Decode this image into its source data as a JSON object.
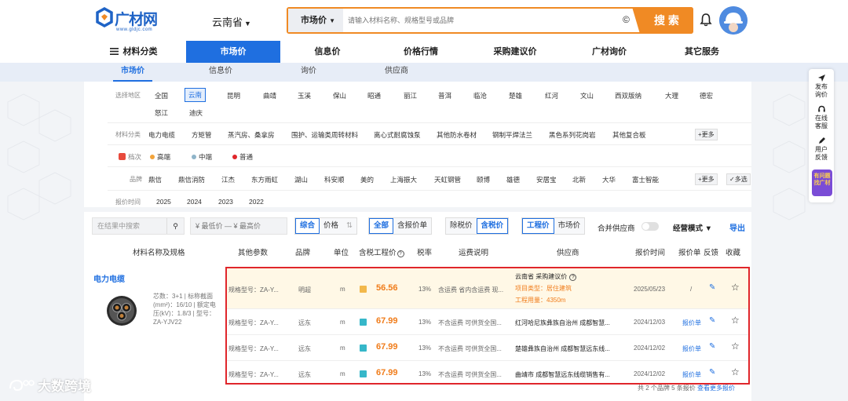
{
  "header": {
    "logo_name": "广材网",
    "logo_url": "www.gldjc.com",
    "region": "云南省",
    "search_type": "市场价",
    "search_placeholder": "请输入材料名称、规格型号或品牌",
    "search_button": "搜 索"
  },
  "main_nav": {
    "items": [
      {
        "label": "材料分类"
      },
      {
        "label": "市场价"
      },
      {
        "label": "信息价"
      },
      {
        "label": "价格行情"
      },
      {
        "label": "采购建议价"
      },
      {
        "label": "广材询价"
      },
      {
        "label": "其它服务"
      }
    ]
  },
  "sub_nav": {
    "items": [
      {
        "label": "市场价"
      },
      {
        "label": "信息价"
      },
      {
        "label": "询价"
      },
      {
        "label": "供应商"
      }
    ]
  },
  "filters": {
    "region": {
      "label": "选择地区",
      "options": [
        "全国",
        "云南",
        "昆明",
        "曲靖",
        "玉溪",
        "保山",
        "昭通",
        "丽江",
        "普洱",
        "临沧",
        "楚雄",
        "红河",
        "文山",
        "西双版纳",
        "大理",
        "德宏",
        "怒江",
        "迪庆"
      ]
    },
    "category": {
      "label": "材料分类",
      "options": [
        "电力电缆",
        "方矩管",
        "蒸汽房、桑拿房",
        "围护、运输类周转材料",
        "离心式耐腐蚀泵",
        "其他防水卷材",
        "钢制平焊法兰",
        "黑色系列花岗岩",
        "其他复合板"
      ],
      "more": "更多"
    },
    "tier": {
      "label": "档次",
      "options": [
        {
          "label": "高端",
          "color": "#f2a33a"
        },
        {
          "label": "中端",
          "color": "#8fb4c9"
        },
        {
          "label": "普通",
          "color": "#e0262b"
        }
      ]
    },
    "brand": {
      "label": "品牌",
      "options": [
        "鼎信",
        "鼎信消防",
        "江杰",
        "东方雨虹",
        "湖山",
        "科安顺",
        "美的",
        "上海振大",
        "天虹钢管",
        "颐博",
        "雄德",
        "安居宝",
        "北新",
        "大华",
        "富士智能"
      ],
      "more": "更多",
      "multi": "多选"
    },
    "time": {
      "label": "报价时间",
      "options": [
        "2025",
        "2024",
        "2023",
        "2022"
      ]
    }
  },
  "toolbar": {
    "search_placeholder": "在结果中搜索",
    "price_range": "¥ 最低价 — ¥ 最高价",
    "sort": [
      "综合",
      "价格"
    ],
    "scope": [
      "全部",
      "含报价单"
    ],
    "tax": [
      "除税价",
      "含税价"
    ],
    "price_type": [
      "工程价",
      "市场价"
    ],
    "merge_label": "合并供应商",
    "mode_label": "经营模式",
    "export_label": "导出"
  },
  "table": {
    "headers": {
      "name": "材料名称及规格",
      "params": "其他参数",
      "brand": "品牌",
      "unit": "单位",
      "price": "含税工程价",
      "tax": "税率",
      "freight": "运费说明",
      "supplier": "供应商",
      "time": "报价时间",
      "quote": "报价单",
      "feedback": "反馈",
      "fav": "收藏"
    }
  },
  "product": {
    "category": "电力电缆",
    "specs": "芯数：3+1 | 标称截面(mm²)：16/10 | 额定电压(kV)：1.8/3 | 型号：ZA-YJV22"
  },
  "offers": [
    {
      "params": "规格型号：ZA-Y...",
      "brand": "明超",
      "unit": "m",
      "price": "56.56",
      "tax": "13%",
      "freight": "含运费 省内含运费 现...",
      "supplier_line1": "云南省 采购建议价",
      "supplier_line2": "项目类型：居住建筑",
      "supplier_line3": "工程用量：4350m",
      "time": "2025/05/23",
      "quote": "/"
    },
    {
      "params": "规格型号：ZA-Y...",
      "brand": "远东",
      "unit": "m",
      "price": "67.99",
      "tax": "13%",
      "freight": "不含运费 可供货全国...",
      "supplier": "红河哈尼族彝族自治州 成都智慧...",
      "time": "2024/12/03",
      "quote": "报价单"
    },
    {
      "params": "规格型号：ZA-Y...",
      "brand": "远东",
      "unit": "m",
      "price": "67.99",
      "tax": "13%",
      "freight": "不含运费 可供货全国...",
      "supplier": "楚雄彝族自治州 成都智慧远东线...",
      "time": "2024/12/02",
      "quote": "报价单"
    },
    {
      "params": "规格型号：ZA-Y...",
      "brand": "远东",
      "unit": "m",
      "price": "67.99",
      "tax": "13%",
      "freight": "不含运费 可供货全国...",
      "supplier": "曲靖市 成都智慧远东线缆销售有...",
      "time": "2024/12/02",
      "quote": "报价单"
    }
  ],
  "footer": {
    "summary": "共 2 个品牌 5 条报价",
    "more_link": "查看更多报价"
  },
  "float_tools": [
    {
      "label": "发布询价"
    },
    {
      "label": "在线客服"
    },
    {
      "label": "用户反馈"
    }
  ],
  "mascot_text": "有问题找广材",
  "watermark": "大数跨境",
  "colors": {
    "brand_blue": "#1f6fe0",
    "accent_orange": "#f08a24",
    "highlight_red": "#e0262b"
  }
}
